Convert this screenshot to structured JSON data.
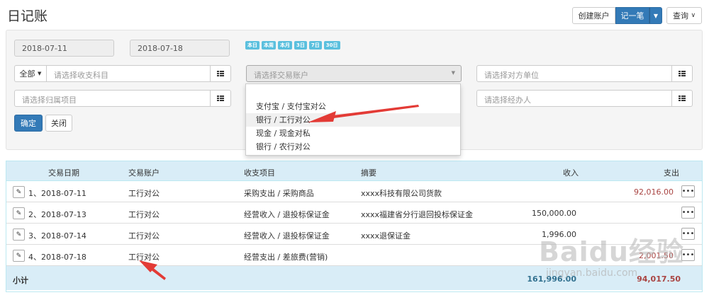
{
  "page": {
    "title": "日记账"
  },
  "actions": {
    "create_account": "创建账户",
    "record": "记一笔",
    "query": "查询"
  },
  "filters": {
    "start_date": "2018-07-11",
    "end_date": "2018-07-18",
    "quick_ranges": [
      "本日",
      "本周",
      "本月",
      "3日",
      "7日",
      "30日"
    ],
    "direction_prefix": "全部",
    "income_subject_placeholder": "请选择收支科目",
    "account_placeholder": "请选择交易账户",
    "counterparty_placeholder": "请选择对方单位",
    "project_placeholder": "请选择归属项目",
    "handler_placeholder": "请选择经办人",
    "confirm": "确定",
    "close": "关闭"
  },
  "account_dropdown": {
    "options": [
      "支付宝 / 支付宝对公",
      "银行 / 工行对公",
      "现金 / 现金对私",
      "银行 / 农行对公"
    ],
    "hovered_index": 1
  },
  "table": {
    "headers": {
      "date": "交易日期",
      "account": "交易账户",
      "subject": "收支项目",
      "summary": "摘要",
      "income": "收入",
      "expense": "支出"
    },
    "rows": [
      {
        "date": "1、2018-07-11",
        "account": "工行对公",
        "subject": "采购支出 / 采购商品",
        "summary": "xxxx科技有限公司货款",
        "income": "",
        "expense": "92,016.00"
      },
      {
        "date": "2、2018-07-13",
        "account": "工行对公",
        "subject": "经营收入 / 退投标保证金",
        "summary": "xxxx福建省分行退回投标保证金",
        "income": "150,000.00",
        "expense": ""
      },
      {
        "date": "3、2018-07-14",
        "account": "工行对公",
        "subject": "经营收入 / 退投标保证金",
        "summary": "xxxx退保证金",
        "income": "1,996.00",
        "expense": ""
      },
      {
        "date": "4、2018-07-18",
        "account": "工行对公",
        "subject": "经营支出 / 差旅费(营销)",
        "summary": "",
        "income": "",
        "expense": "2,001.50"
      }
    ],
    "subtotal": {
      "label": "小计",
      "income": "161,996.00",
      "expense": "94,017.50"
    }
  },
  "watermark": {
    "main": "Baidu经验",
    "sub": "jingyan.baidu.com"
  },
  "colors": {
    "primary": "#337ab7",
    "info": "#5bc0de",
    "danger": "#a94442",
    "header_bg": "#d9edf7",
    "arrow": "#e33b36"
  }
}
